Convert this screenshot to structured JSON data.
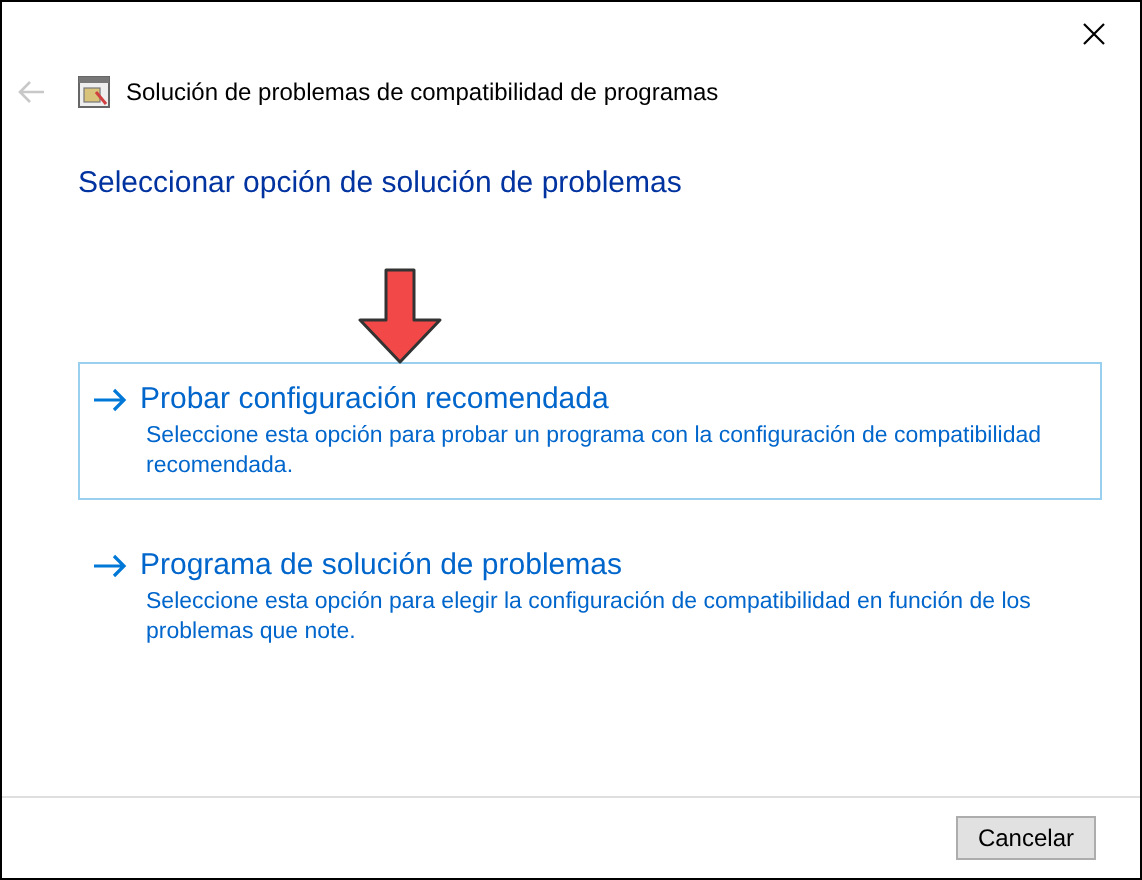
{
  "window": {
    "title": "Solución de problemas de compatibilidad de programas",
    "back_disabled": true
  },
  "heading": "Seleccionar opción de solución de problemas",
  "options": [
    {
      "title": "Probar configuración recomendada",
      "description": "Seleccione esta opción para probar un programa con la configuración de compatibilidad recomendada.",
      "selected": true
    },
    {
      "title": "Programa de solución de problemas",
      "description": "Seleccione esta opción para elegir la configuración de compatibilidad en función de los problemas que note.",
      "selected": false
    }
  ],
  "buttons": [
    "Cancelar"
  ]
}
